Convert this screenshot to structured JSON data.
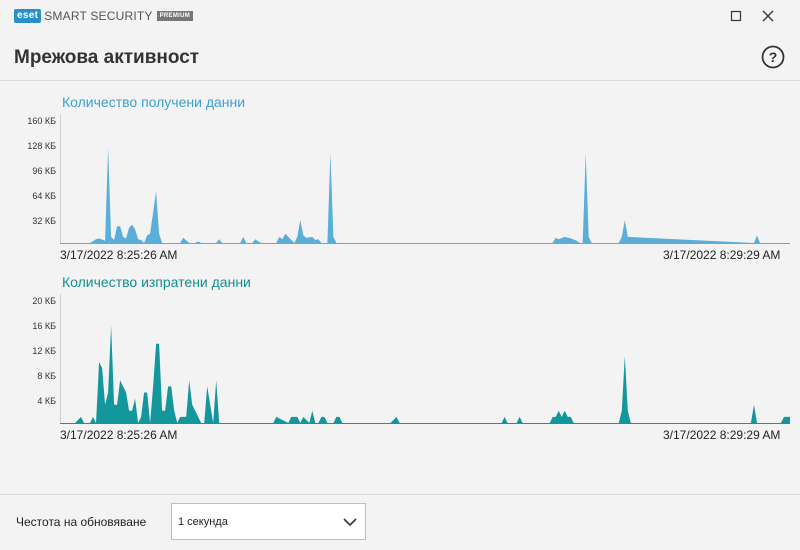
{
  "app": {
    "logo_mark": "eset",
    "product": "SMART SECURITY",
    "edition": "PREMIUM"
  },
  "window": {
    "maximize_icon": "maximize-icon",
    "close_icon": "close-icon"
  },
  "page": {
    "title": "Мрежова активност",
    "help_icon": "question-circle-icon"
  },
  "colors": {
    "received": "#5aaed8",
    "received_title": "#3c9fd0",
    "sent": "#14979c",
    "sent_title": "#128e92",
    "accent": "#2a90c8"
  },
  "chart_data": [
    {
      "type": "area",
      "title": "Количество получени данни",
      "ylabel": "",
      "yticks": [
        "32 КБ",
        "64 КБ",
        "96 КБ",
        "128 КБ",
        "160 КБ"
      ],
      "ytick_values": [
        32,
        64,
        96,
        128,
        160
      ],
      "ylim": [
        0,
        160
      ],
      "x_start_label": "3/17/2022 8:25:26 AM",
      "x_end_label": "3/17/2022 8:29:29 AM",
      "xlim": [
        0,
        243
      ],
      "series": [
        {
          "x": [
            0,
            10,
            12,
            13,
            15,
            16,
            17,
            18,
            19,
            20,
            21,
            22,
            23,
            24,
            25,
            26,
            27,
            28,
            29,
            30,
            32,
            33,
            34,
            35,
            36,
            37,
            38,
            39,
            40,
            41,
            43,
            45,
            46,
            47,
            48,
            52,
            53,
            54,
            55,
            60,
            61,
            62,
            64,
            65,
            66,
            67,
            70,
            72,
            73,
            74,
            75,
            78,
            79,
            80,
            81,
            82,
            84,
            85,
            86,
            87,
            88,
            89,
            90,
            91,
            92,
            93,
            94,
            95,
            96,
            97,
            98,
            164,
            165,
            166,
            168,
            170,
            172,
            173,
            174,
            175,
            176,
            177,
            178,
            186,
            187,
            188,
            189,
            231,
            232,
            233,
            243
          ],
          "values": [
            0,
            0,
            5,
            6,
            3,
            125,
            8,
            4,
            22,
            22,
            8,
            6,
            20,
            24,
            18,
            5,
            4,
            0,
            10,
            12,
            68,
            12,
            0,
            0,
            0,
            0,
            0,
            0,
            0,
            7,
            0,
            0,
            2,
            0,
            0,
            0,
            5,
            0,
            0,
            0,
            8,
            0,
            0,
            5,
            2,
            0,
            0,
            0,
            8,
            5,
            12,
            0,
            8,
            30,
            10,
            7,
            8,
            4,
            5,
            0,
            0,
            0,
            118,
            8,
            0,
            0,
            0,
            0,
            0,
            0,
            0,
            0,
            7,
            5,
            8,
            6,
            3,
            0,
            0,
            118,
            8,
            0,
            0,
            0,
            8,
            30,
            8,
            0,
            10,
            0,
            0
          ]
        }
      ]
    },
    {
      "type": "area",
      "title": "Количество изпратени данни",
      "ylabel": "",
      "yticks": [
        "4 КБ",
        "8 КБ",
        "12 КБ",
        "16 КБ",
        "20 КБ"
      ],
      "ytick_values": [
        4,
        8,
        12,
        16,
        20
      ],
      "ylim": [
        0,
        20
      ],
      "x_start_label": "3/17/2022 8:25:26 AM",
      "x_end_label": "3/17/2022 8:29:29 AM",
      "xlim": [
        0,
        243
      ],
      "series": [
        {
          "x": [
            0,
            5,
            7,
            8,
            10,
            11,
            12,
            13,
            14,
            15,
            16,
            17,
            18,
            19,
            20,
            21,
            22,
            23,
            24,
            25,
            26,
            27,
            28,
            29,
            30,
            31,
            32,
            33,
            34,
            35,
            36,
            37,
            38,
            39,
            40,
            42,
            43,
            44,
            47,
            48,
            49,
            51,
            52,
            53,
            56,
            60,
            62,
            63,
            66,
            68,
            70,
            71,
            72,
            76,
            77,
            79,
            80,
            81,
            83,
            84,
            85,
            86,
            87,
            88,
            89,
            90,
            91,
            92,
            93,
            94,
            95,
            96,
            97,
            98,
            100,
            102,
            103,
            104,
            110,
            112,
            113,
            114,
            147,
            148,
            149,
            152,
            153,
            154,
            163,
            164,
            165,
            166,
            167,
            168,
            169,
            170,
            171,
            172,
            173,
            174,
            175,
            185,
            186,
            187,
            188,
            189,
            190,
            230,
            231,
            232,
            233,
            240,
            241,
            243
          ],
          "values": [
            0,
            0,
            1,
            0,
            0,
            1,
            0,
            10,
            9,
            3,
            5,
            16,
            3,
            3,
            7,
            6,
            5,
            2,
            2,
            4,
            0,
            1,
            5,
            5,
            0,
            6,
            13,
            13,
            2,
            2,
            6,
            6,
            2,
            0,
            1,
            1,
            7,
            3,
            0,
            0,
            6,
            0,
            7,
            0,
            0,
            0,
            0,
            0,
            0,
            0,
            0,
            0,
            1,
            0,
            1,
            1,
            0,
            1,
            0,
            2,
            0,
            0,
            1,
            1,
            0,
            0,
            0,
            1,
            1,
            0,
            0,
            0,
            0,
            0,
            0,
            0,
            0,
            0,
            0,
            1,
            0,
            0,
            0,
            1,
            0,
            0,
            1,
            0,
            0,
            1,
            1,
            2,
            1,
            2,
            1,
            1,
            0,
            0,
            0,
            0,
            0,
            0,
            0,
            2,
            11,
            2,
            0,
            0,
            3,
            0,
            0,
            0,
            1,
            1
          ]
        }
      ]
    }
  ],
  "footer": {
    "update_label": "Честота на обновяване",
    "update_value": "1 секунда",
    "dropdown_icon": "chevron-down-icon"
  }
}
